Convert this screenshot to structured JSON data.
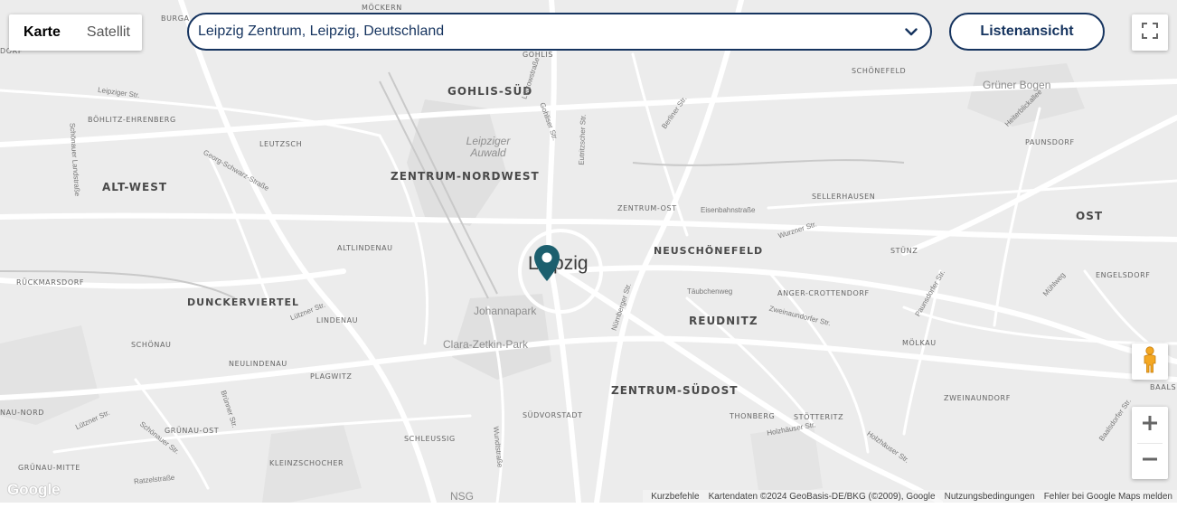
{
  "map_type": {
    "map": "Karte",
    "satellite": "Satellit"
  },
  "search": {
    "value": "Leipzig Zentrum, Leipzig, Deutschland"
  },
  "list_view_label": "Listenansicht",
  "city_label": "Leipzig",
  "district_labels": {
    "gohlis_sued": "GOHLIS-SÜD",
    "zentrum_nordwest": "ZENTRUM-NORDWEST",
    "alt_west": "ALT-WEST",
    "neuschoenefeld": "NEUSCHÖNEFELD",
    "reudnitz": "REUDNITZ",
    "zentrum_suedost": "ZENTRUM-SÜDOST",
    "dunckerviertel": "DUNCKERVIERTEL",
    "ost": "OST"
  },
  "small_labels": {
    "moeckern": "MÖCKERN",
    "burga": "BURGA",
    "gohlis": "GOHLIS",
    "schoenefeld": "SCHÖNEFELD",
    "boehlitz": "BÖHLITZ-EHRENBERG",
    "leutzsch": "LEUTZSCH",
    "paunsdorf": "PAUNSDORF",
    "sellerhausen": "SELLERHAUSEN",
    "zentrum_ost": "ZENTRUM-OST",
    "altlindenau": "ALTLINDENAU",
    "stuenz": "STÜNZ",
    "rueckmarsdorf": "RÜCKMARSDORF",
    "engelsdorf": "ENGELSDORF",
    "anger": "ANGER-CROTTENDORF",
    "lindenau": "LINDENAU",
    "schoenau": "SCHÖNAU",
    "moelkau": "MÖLKAU",
    "neulindenau": "NEULINDENAU",
    "plagwitz": "PLAGWITZ",
    "zweinaundorf": "ZWEINAUNDORF",
    "baals": "BAALS",
    "nau_nord": "NAU-NORD",
    "suedvorstadt": "SÜDVORSTADT",
    "thonberg": "THONBERG",
    "stoetteritz": "STÖTTERITZ",
    "gruenau_ost": "GRÜNAU-OST",
    "schleussig": "SCHLEUSSIG",
    "kleinzschocher": "KLEINZSCHOCHER",
    "gruenau_mitte": "GRÜNAU-MITTE",
    "dorf": "DORF"
  },
  "street_labels": {
    "leipziger_str": "Leipziger Str.",
    "georg_schwarz": "Georg-Schwarz-Straße",
    "eisenbahnstrasse": "Eisenbahnstraße",
    "wurzner": "Wurzner Str.",
    "taeubchenweg": "Täubchenweg",
    "zweinaundorfer": "Zweinaundorfer Str.",
    "luetzner1": "Lützner Str.",
    "luetzner2": "Lützner Str.",
    "holzhaeuser1": "Holzhäuser Str.",
    "holzhaeuser2": "Holzhäuser Str.",
    "ratzelstrasse": "Ratzelstraße",
    "schoenauer": "Schönauer Str.",
    "heiterblick": "Heiterblickallee",
    "muehlweg": "Mühlweg",
    "paunsdorfer": "Paunsdorfer Str.",
    "baalsdorfer": "Baalsdorfer Str.",
    "nuernberger": "Nürnberger Str.",
    "wundtstrasse": "Wundtstraße",
    "berliner": "Berliner Str.",
    "lutzowstrasse": "Lützowstraße",
    "gohliser": "Gohliser Str.",
    "eutritzscher": "Eutritzscher Str.",
    "bruenner": "Brünner Str.",
    "schoenauer_landstr": "Schönauer Landstraße"
  },
  "park_labels": {
    "auwald": "Leipziger Auwald",
    "johannapark": "Johannapark",
    "clara": "Clara-Zetkin-Park",
    "gruener_bogen": "Grüner Bogen",
    "nsg": "NSG"
  },
  "attribution": {
    "shortcuts": "Kurzbefehle",
    "data": "Kartendaten ©2024 GeoBasis-DE/BKG (©2009), Google",
    "terms": "Nutzungsbedingungen",
    "report": "Fehler bei Google Maps melden"
  },
  "google_logo": "Google",
  "colors": {
    "brand_navy": "#16345f",
    "marker_teal": "#1c5f6e"
  },
  "icons": [
    "chevron-down-icon",
    "fullscreen-icon",
    "pegman-icon",
    "zoom-in-icon",
    "zoom-out-icon",
    "location-pin-icon"
  ]
}
